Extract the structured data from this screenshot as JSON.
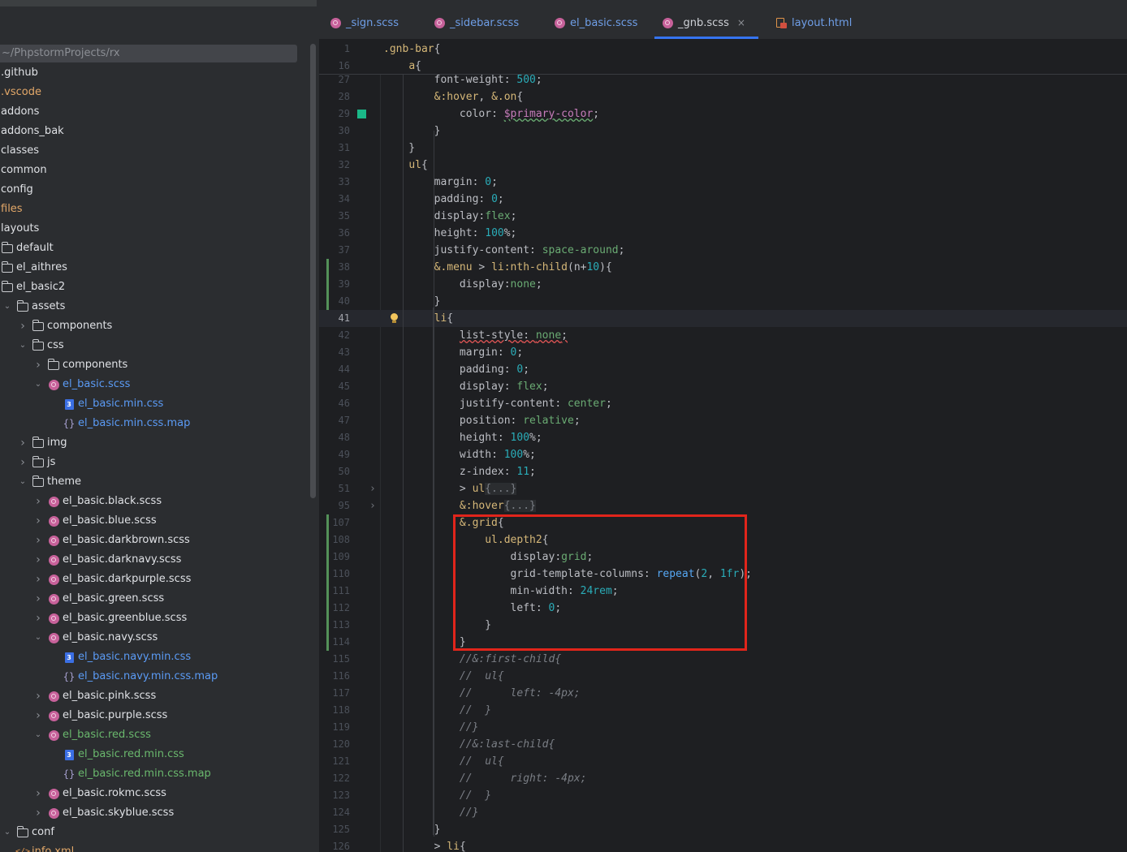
{
  "sidebar": {
    "project_path": "~/PhpstormProjects/rx",
    "items": [
      {
        "label": ".github",
        "color": "git",
        "icon": "none",
        "indent": 0,
        "chevron": "none"
      },
      {
        "label": ".vscode",
        "color": "orange",
        "icon": "none",
        "indent": 0,
        "chevron": "none"
      },
      {
        "label": "addons",
        "color": "git",
        "icon": "none",
        "indent": 0,
        "chevron": "none"
      },
      {
        "label": "addons_bak",
        "color": "git",
        "icon": "none",
        "indent": 0,
        "chevron": "none"
      },
      {
        "label": "classes",
        "color": "git",
        "icon": "none",
        "indent": 0,
        "chevron": "none"
      },
      {
        "label": "common",
        "color": "git",
        "icon": "none",
        "indent": 0,
        "chevron": "none"
      },
      {
        "label": "config",
        "color": "git",
        "icon": "none",
        "indent": 0,
        "chevron": "none"
      },
      {
        "label": "files",
        "color": "orange",
        "icon": "none",
        "indent": 0,
        "chevron": "none"
      },
      {
        "label": "layouts",
        "color": "git",
        "icon": "none",
        "indent": 0,
        "chevron": "none"
      },
      {
        "label": "default",
        "color": "git",
        "icon": "folder-icon",
        "indent": 0,
        "chevron": "none"
      },
      {
        "label": "el_aithres",
        "color": "git",
        "icon": "folder-icon",
        "indent": 0,
        "chevron": "none"
      },
      {
        "label": "el_basic2",
        "color": "git",
        "icon": "folder-icon",
        "indent": 0,
        "chevron": "none"
      },
      {
        "label": "assets",
        "color": "git",
        "icon": "folder-icon",
        "indent": 1,
        "chevron": "down"
      },
      {
        "label": "components",
        "color": "git",
        "icon": "folder-icon",
        "indent": 2,
        "chevron": "right"
      },
      {
        "label": "css",
        "color": "git",
        "icon": "folder-icon",
        "indent": 2,
        "chevron": "down"
      },
      {
        "label": "components",
        "color": "git",
        "icon": "folder-icon",
        "indent": 3,
        "chevron": "right"
      },
      {
        "label": "el_basic.scss",
        "color": "blue",
        "icon": "sass-icon",
        "indent": 3,
        "chevron": "down"
      },
      {
        "label": "el_basic.min.css",
        "color": "blue",
        "icon": "css-icon",
        "indent": 4,
        "chevron": "none"
      },
      {
        "label": "el_basic.min.css.map",
        "color": "blue",
        "icon": "map-icon",
        "indent": 4,
        "chevron": "none"
      },
      {
        "label": "img",
        "color": "git",
        "icon": "folder-icon",
        "indent": 2,
        "chevron": "right"
      },
      {
        "label": "js",
        "color": "git",
        "icon": "folder-icon",
        "indent": 2,
        "chevron": "right"
      },
      {
        "label": "theme",
        "color": "git",
        "icon": "folder-icon",
        "indent": 2,
        "chevron": "down"
      },
      {
        "label": "el_basic.black.scss",
        "color": "git",
        "icon": "sass-icon",
        "indent": 3,
        "chevron": "right"
      },
      {
        "label": "el_basic.blue.scss",
        "color": "git",
        "icon": "sass-icon",
        "indent": 3,
        "chevron": "right"
      },
      {
        "label": "el_basic.darkbrown.scss",
        "color": "git",
        "icon": "sass-icon",
        "indent": 3,
        "chevron": "right"
      },
      {
        "label": "el_basic.darknavy.scss",
        "color": "git",
        "icon": "sass-icon",
        "indent": 3,
        "chevron": "right"
      },
      {
        "label": "el_basic.darkpurple.scss",
        "color": "git",
        "icon": "sass-icon",
        "indent": 3,
        "chevron": "right"
      },
      {
        "label": "el_basic.green.scss",
        "color": "git",
        "icon": "sass-icon",
        "indent": 3,
        "chevron": "right"
      },
      {
        "label": "el_basic.greenblue.scss",
        "color": "git",
        "icon": "sass-icon",
        "indent": 3,
        "chevron": "right"
      },
      {
        "label": "el_basic.navy.scss",
        "color": "git",
        "icon": "sass-icon",
        "indent": 3,
        "chevron": "down"
      },
      {
        "label": "el_basic.navy.min.css",
        "color": "blue",
        "icon": "css-icon",
        "indent": 4,
        "chevron": "none"
      },
      {
        "label": "el_basic.navy.min.css.map",
        "color": "blue",
        "icon": "map-icon",
        "indent": 4,
        "chevron": "none"
      },
      {
        "label": "el_basic.pink.scss",
        "color": "git",
        "icon": "sass-icon",
        "indent": 3,
        "chevron": "right"
      },
      {
        "label": "el_basic.purple.scss",
        "color": "git",
        "icon": "sass-icon",
        "indent": 3,
        "chevron": "right"
      },
      {
        "label": "el_basic.red.scss",
        "color": "green",
        "icon": "sass-icon",
        "indent": 3,
        "chevron": "down"
      },
      {
        "label": "el_basic.red.min.css",
        "color": "green",
        "icon": "css-icon",
        "indent": 4,
        "chevron": "none"
      },
      {
        "label": "el_basic.red.min.css.map",
        "color": "green",
        "icon": "map-icon",
        "indent": 4,
        "chevron": "none"
      },
      {
        "label": "el_basic.rokmc.scss",
        "color": "git",
        "icon": "sass-icon",
        "indent": 3,
        "chevron": "right"
      },
      {
        "label": "el_basic.skyblue.scss",
        "color": "git",
        "icon": "sass-icon",
        "indent": 3,
        "chevron": "right"
      },
      {
        "label": "conf",
        "color": "git",
        "icon": "folder-icon",
        "indent": 0,
        "chevron": "down"
      },
      {
        "label": "info.xml",
        "color": "orange",
        "icon": "xml-icon",
        "indent": 1,
        "chevron": "none"
      }
    ]
  },
  "tabs": [
    {
      "label": "_sign.scss",
      "icon": "sass-icon",
      "active": false,
      "closable": false
    },
    {
      "label": "_sidebar.scss",
      "icon": "sass-icon",
      "active": false,
      "closable": false
    },
    {
      "label": "el_basic.scss",
      "icon": "sass-icon",
      "active": false,
      "closable": false
    },
    {
      "label": "_gnb.scss",
      "icon": "sass-icon",
      "active": true,
      "closable": true
    },
    {
      "label": "layout.html",
      "icon": "html-icon",
      "active": false,
      "closable": false
    }
  ],
  "tab_close_glyph": "×",
  "editor": {
    "sticky_lines": [
      {
        "num": "1",
        "html": "<span class=\"tok-sel\">.gnb-bar</span>{"
      },
      {
        "num": "16",
        "html": "    <span class=\"tok-sel\">a</span>{"
      }
    ],
    "lines": [
      {
        "num": "27",
        "html": "        <span class=\"tok-prop\">font-weight</span>: <span class=\"tok-num\">500</span>;"
      },
      {
        "num": "28",
        "html": "        <span class=\"tok-sel\">&amp;:hover</span>, <span class=\"tok-sel\">&amp;.on</span>{"
      },
      {
        "num": "29",
        "html": "            <span class=\"tok-prop\">color</span>: <span class=\"tok-var\">$primary-color</span>;",
        "swatch": true
      },
      {
        "num": "30",
        "html": "        }"
      },
      {
        "num": "31",
        "html": "    }"
      },
      {
        "num": "32",
        "html": "    <span class=\"tok-sel\">ul</span>{"
      },
      {
        "num": "33",
        "html": "        <span class=\"tok-prop\">margin</span>: <span class=\"tok-num\">0</span>;"
      },
      {
        "num": "34",
        "html": "        <span class=\"tok-prop\">padding</span>: <span class=\"tok-num\">0</span>;"
      },
      {
        "num": "35",
        "html": "        <span class=\"tok-prop\">display</span>:<span class=\"tok-kw\">flex</span>;"
      },
      {
        "num": "36",
        "html": "        <span class=\"tok-prop\">height</span>: <span class=\"tok-num\">100</span>%;"
      },
      {
        "num": "37",
        "html": "        <span class=\"tok-prop\">justify-content</span>: <span class=\"tok-kw\">space-around</span>;"
      },
      {
        "num": "38",
        "html": "        <span class=\"tok-sel\">&amp;.menu</span> &gt; <span class=\"tok-sel\">li:nth-child</span>(n+<span class=\"tok-num\">10</span>){",
        "vcs": true
      },
      {
        "num": "39",
        "html": "            <span class=\"tok-prop\">display</span>:<span class=\"tok-kw\">none</span>;",
        "vcs": true
      },
      {
        "num": "40",
        "html": "        }",
        "vcs": true
      },
      {
        "num": "41",
        "html": "        <span class=\"tok-sel\">li</span>{",
        "current": true,
        "bulb": true
      },
      {
        "num": "42",
        "html": "            <span class=\"tok-prop err\">list-style</span><span class=\"err\">: </span><span class=\"tok-kw err\">none</span><span class=\"err\">;</span>"
      },
      {
        "num": "43",
        "html": "            <span class=\"tok-prop\">margin</span>: <span class=\"tok-num\">0</span>;"
      },
      {
        "num": "44",
        "html": "            <span class=\"tok-prop\">padding</span>: <span class=\"tok-num\">0</span>;"
      },
      {
        "num": "45",
        "html": "            <span class=\"tok-prop\">display</span>: <span class=\"tok-kw\">flex</span>;"
      },
      {
        "num": "46",
        "html": "            <span class=\"tok-prop\">justify-content</span>: <span class=\"tok-kw\">center</span>;"
      },
      {
        "num": "47",
        "html": "            <span class=\"tok-prop\">position</span>: <span class=\"tok-kw\">relative</span>;"
      },
      {
        "num": "48",
        "html": "            <span class=\"tok-prop\">height</span>: <span class=\"tok-num\">100</span>%;"
      },
      {
        "num": "49",
        "html": "            <span class=\"tok-prop\">width</span>: <span class=\"tok-num\">100</span>%;"
      },
      {
        "num": "50",
        "html": "            <span class=\"tok-prop\">z-index</span>: <span class=\"tok-num\">11</span>;"
      },
      {
        "num": "51",
        "html": "            &gt; <span class=\"tok-sel\">ul</span><span class=\"tok-ph\">{...}</span>",
        "fold": true
      },
      {
        "num": "95",
        "html": "            <span class=\"tok-sel\">&amp;:hover</span><span class=\"tok-ph\">{...}</span>",
        "fold": true
      },
      {
        "num": "107",
        "html": "            <span class=\"tok-sel\">&amp;.grid</span>{",
        "vcs": true
      },
      {
        "num": "108",
        "html": "                <span class=\"tok-sel\">ul.depth2</span>{",
        "vcs": true
      },
      {
        "num": "109",
        "html": "                    <span class=\"tok-prop\">display</span>:<span class=\"tok-kw\">grid</span>;",
        "vcs": true
      },
      {
        "num": "110",
        "html": "                    <span class=\"tok-prop\">grid-template-columns</span>: <span class=\"tok-fn\">repeat</span>(<span class=\"tok-num\">2</span>, <span class=\"tok-num\">1fr</span>);",
        "vcs": true
      },
      {
        "num": "111",
        "html": "                    <span class=\"tok-prop\">min-width</span>: <span class=\"tok-num\">24rem</span>;",
        "vcs": true
      },
      {
        "num": "112",
        "html": "                    <span class=\"tok-prop\">left</span>: <span class=\"tok-num\">0</span>;",
        "vcs": true
      },
      {
        "num": "113",
        "html": "                }",
        "vcs": true
      },
      {
        "num": "114",
        "html": "            }",
        "vcs": true
      },
      {
        "num": "115",
        "html": "            <span class=\"tok-cmt\">//&amp;:first-child{</span>"
      },
      {
        "num": "116",
        "html": "            <span class=\"tok-cmt\">//  ul{</span>"
      },
      {
        "num": "117",
        "html": "            <span class=\"tok-cmt\">//      left: -4px;</span>"
      },
      {
        "num": "118",
        "html": "            <span class=\"tok-cmt\">//  }</span>"
      },
      {
        "num": "119",
        "html": "            <span class=\"tok-cmt\">//}</span>"
      },
      {
        "num": "120",
        "html": "            <span class=\"tok-cmt\">//&amp;:last-child{</span>"
      },
      {
        "num": "121",
        "html": "            <span class=\"tok-cmt\">//  ul{</span>"
      },
      {
        "num": "122",
        "html": "            <span class=\"tok-cmt\">//      right: -4px;</span>"
      },
      {
        "num": "123",
        "html": "            <span class=\"tok-cmt\">//  }</span>"
      },
      {
        "num": "124",
        "html": "            <span class=\"tok-cmt\">//}</span>"
      },
      {
        "num": "125",
        "html": "        }"
      },
      {
        "num": "126",
        "html": "        &gt; <span class=\"tok-sel\">li</span>{"
      }
    ]
  },
  "colors": {
    "accent": "#3574f0",
    "highlight_box": "#e1251b",
    "color_swatch": "#1ab888",
    "vcs_modified": "#549159"
  }
}
